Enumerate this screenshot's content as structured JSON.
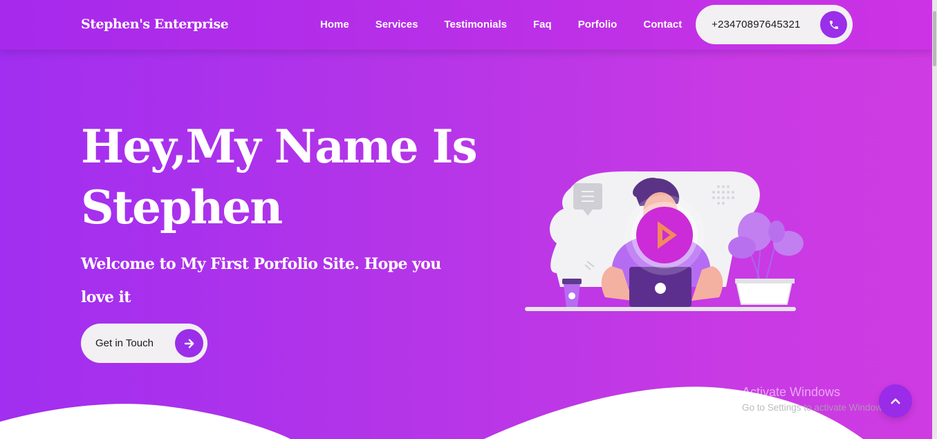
{
  "header": {
    "brand": "Stephen's Enterprise",
    "nav": [
      {
        "label": "Home"
      },
      {
        "label": "Services"
      },
      {
        "label": "Testimonials"
      },
      {
        "label": "Faq"
      },
      {
        "label": "Porfolio"
      },
      {
        "label": "Contact"
      }
    ],
    "phone": "+23470897645321",
    "phone_icon": "phone-icon"
  },
  "hero": {
    "title": "Hey,My Name Is Stephen",
    "subtitle": "Welcome to My First Porfolio Site. Hope you love it",
    "cta_label": "Get in Touch",
    "cta_icon": "arrow-right-icon",
    "video_icon": "play-icon"
  },
  "watermark": {
    "title": "Activate Windows",
    "subtitle": "Go to Settings to activate Windows."
  },
  "back_to_top_icon": "chevron-up-icon",
  "colors": {
    "accent": "#9b2ee9",
    "gradient_start": "#a12ef0",
    "gradient_end": "#cf3be2",
    "pill_bg": "#f2f0f3",
    "play_button": "#cc2bd8"
  }
}
